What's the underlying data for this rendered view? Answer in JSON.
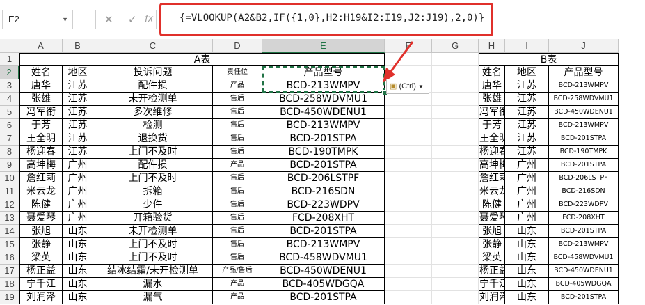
{
  "name_box": "E2",
  "formula_tools": {
    "cancel": "✕",
    "confirm": "✓",
    "fx": "fx"
  },
  "formula": "{=VLOOKUP(A2&B2,IF({1,0},H2:H19&I2:I19,J2:J19),2,0)}",
  "paste_options": "(Ctrl)",
  "columns": [
    "A",
    "B",
    "C",
    "D",
    "E",
    "F",
    "G",
    "H",
    "I",
    "J"
  ],
  "rows": [
    "1",
    "2",
    "3",
    "4",
    "5",
    "6",
    "7",
    "8",
    "9",
    "10",
    "11",
    "12",
    "13",
    "14",
    "15",
    "16",
    "17",
    "18",
    "19"
  ],
  "table_a": {
    "title": "A表",
    "headers": [
      "姓名",
      "地区",
      "投诉问题",
      "责任位",
      "产品型号"
    ],
    "rows": [
      [
        "唐华",
        "江苏",
        "配件损",
        "产品",
        "BCD-213WMPV"
      ],
      [
        "张雄",
        "江苏",
        "未开检测单",
        "售后",
        "BCD-258WDVMU1"
      ],
      [
        "冯军衔",
        "江苏",
        "多次维修",
        "售后",
        "BCD-450WDENU1"
      ],
      [
        "于芳",
        "江苏",
        "检测",
        "售后",
        "BCD-213WMPV"
      ],
      [
        "王全明",
        "江苏",
        "退换货",
        "售后",
        "BCD-201STPA"
      ],
      [
        "杨迎春",
        "江苏",
        "上门不及时",
        "售后",
        "BCD-190TMPK"
      ],
      [
        "高坤梅",
        "广州",
        "配件损",
        "产品",
        "BCD-201STPA"
      ],
      [
        "詹红莉",
        "广州",
        "上门不及时",
        "售后",
        "BCD-206LSTPF"
      ],
      [
        "米云龙",
        "广州",
        "拆箱",
        "售后",
        "BCD-216SDN"
      ],
      [
        "陈健",
        "广州",
        "少件",
        "售后",
        "BCD-223WDPV"
      ],
      [
        "聂爱琴",
        "广州",
        "开箱验货",
        "售后",
        "FCD-208XHT"
      ],
      [
        "张旭",
        "山东",
        "未开检测单",
        "售后",
        "BCD-201STPA"
      ],
      [
        "张静",
        "山东",
        "上门不及时",
        "售后",
        "BCD-213WMPV"
      ],
      [
        "梁英",
        "山东",
        "上门不及时",
        "售后",
        "BCD-458WDVMU1"
      ],
      [
        "杨正益",
        "山东",
        "结冰结霜/未开检测单",
        "产品/售后",
        "BCD-450WDENU1"
      ],
      [
        "宁千江",
        "山东",
        "漏水",
        "产品",
        "BCD-405WDGQA"
      ],
      [
        "刘润泽",
        "山东",
        "漏气",
        "产品",
        "BCD-201STPA"
      ]
    ]
  },
  "table_b": {
    "title": "B表",
    "headers": [
      "姓名",
      "地区",
      "产品型号"
    ],
    "rows": [
      [
        "唐华",
        "江苏",
        "BCD-213WMPV"
      ],
      [
        "张雄",
        "江苏",
        "BCD-258WDVMU1"
      ],
      [
        "冯军衔",
        "江苏",
        "BCD-450WDENU1"
      ],
      [
        "于芳",
        "江苏",
        "BCD-213WMPV"
      ],
      [
        "王全明",
        "江苏",
        "BCD-201STPA"
      ],
      [
        "杨迎春",
        "江苏",
        "BCD-190TMPK"
      ],
      [
        "高坤梅",
        "广州",
        "BCD-201STPA"
      ],
      [
        "詹红莉",
        "广州",
        "BCD-206LSTPF"
      ],
      [
        "米云龙",
        "广州",
        "BCD-216SDN"
      ],
      [
        "陈健",
        "广州",
        "BCD-223WDPV"
      ],
      [
        "聂爱琴",
        "广州",
        "FCD-208XHT"
      ],
      [
        "张旭",
        "山东",
        "BCD-201STPA"
      ],
      [
        "张静",
        "山东",
        "BCD-213WMPV"
      ],
      [
        "梁英",
        "山东",
        "BCD-458WDVMU1"
      ],
      [
        "杨正益",
        "山东",
        "BCD-450WDENU1"
      ],
      [
        "宁千江",
        "山东",
        "BCD-405WDGQA"
      ],
      [
        "刘润泽",
        "山东",
        "BCD-201STPA"
      ]
    ]
  },
  "colors": {
    "selection": "#217346",
    "highlight_box": "#e0302b",
    "arrow": "#e0302b"
  }
}
